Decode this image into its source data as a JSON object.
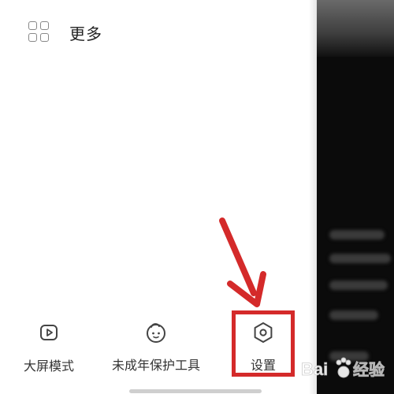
{
  "drawer": {
    "more_label": "更多",
    "more_icon": "grid-icon"
  },
  "quick_items": [
    {
      "label": "大屏模式",
      "icon": "play-screen-icon"
    },
    {
      "label": "未成年保护工具",
      "icon": "child-face-icon"
    },
    {
      "label": "设置",
      "icon": "settings-hexagon-icon"
    }
  ],
  "annotation": {
    "color": "#d42a2a"
  },
  "watermark": {
    "text_latin": "Bai",
    "text_cn": "经验",
    "brand": "baidu"
  }
}
